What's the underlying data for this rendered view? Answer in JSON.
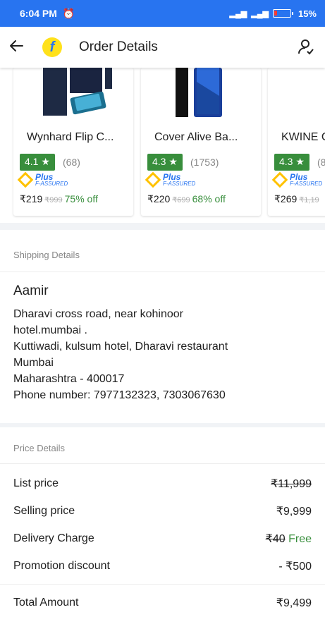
{
  "status_bar": {
    "time": "6:04 PM",
    "battery_percent": "15%"
  },
  "header": {
    "title": "Order Details"
  },
  "products": [
    {
      "name": "Wynhard Flip C...",
      "rating": "4.1 ★",
      "reviews": "(68)",
      "plus": "Plus",
      "assured": "F-ASSURED",
      "price": "₹219",
      "mrp": "₹999",
      "off": "75% off"
    },
    {
      "name": "Cover Alive Ba...",
      "rating": "4.3 ★",
      "reviews": "(1753)",
      "plus": "Plus",
      "assured": "F-ASSURED",
      "price": "₹220",
      "mrp": "₹699",
      "off": "68% off"
    },
    {
      "name": "KWINE C",
      "rating": "4.3 ★",
      "reviews": "(8",
      "plus": "Plus",
      "assured": "F-ASSURED",
      "price": "₹269",
      "mrp": "₹1,19",
      "off": ""
    }
  ],
  "shipping": {
    "section_title": "Shipping Details",
    "name": "Aamir",
    "lines": [
      "Dharavi cross road, near kohinoor",
      "hotel.mumbai .",
      "Kuttiwadi, kulsum hotel, Dharavi restaurant",
      "Mumbai",
      "Maharashtra - 400017",
      "Phone number: 7977132323, 7303067630"
    ]
  },
  "price_details": {
    "section_title": "Price Details",
    "list_price_label": "List price",
    "list_price_value": "₹11,999",
    "selling_price_label": "Selling price",
    "selling_price_value": "₹9,999",
    "delivery_label": "Delivery Charge",
    "delivery_original": "₹40",
    "delivery_value": "Free",
    "promotion_label": "Promotion discount",
    "promotion_value": "- ₹500",
    "total_label": "Total Amount",
    "total_value": "₹9,499"
  }
}
